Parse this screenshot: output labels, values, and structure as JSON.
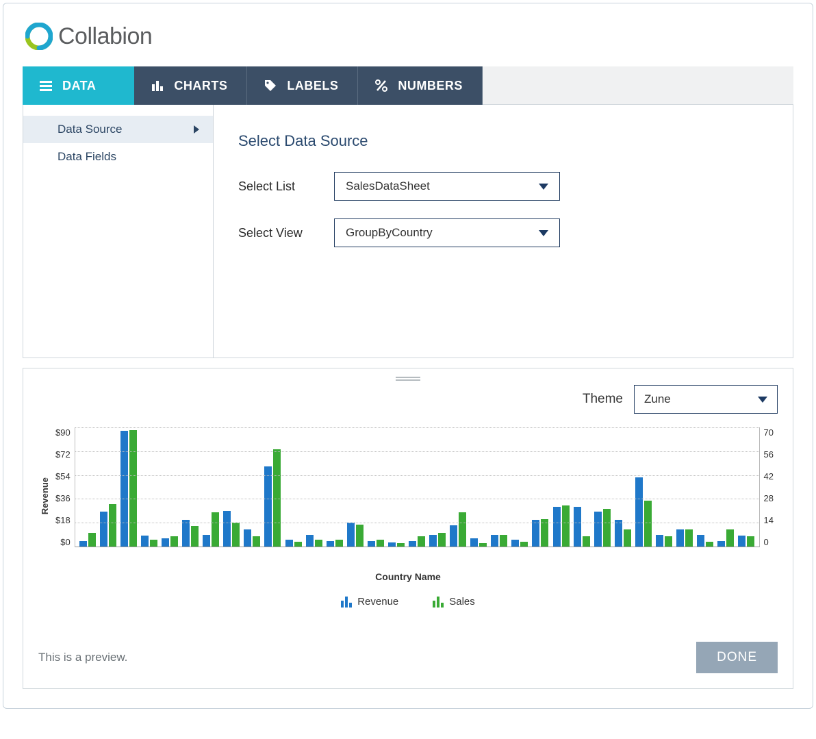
{
  "brand": {
    "name": "Collabion"
  },
  "tabs": [
    {
      "key": "data",
      "label": "DATA",
      "active": true
    },
    {
      "key": "charts",
      "label": "CHARTS",
      "active": false
    },
    {
      "key": "labels",
      "label": "LABELS",
      "active": false
    },
    {
      "key": "numbers",
      "label": "NUMBERS",
      "active": false
    }
  ],
  "sidebar": {
    "items": [
      {
        "key": "data-source",
        "label": "Data Source",
        "active": true
      },
      {
        "key": "data-fields",
        "label": "Data Fields",
        "active": false
      }
    ]
  },
  "content": {
    "title": "Select Data Source",
    "select_list_label": "Select List",
    "select_list_value": "SalesDataSheet",
    "select_view_label": "Select View",
    "select_view_value": "GroupByCountry"
  },
  "preview": {
    "theme_label": "Theme",
    "theme_value": "Zune",
    "note": "This is a preview.",
    "done_label": "DONE"
  },
  "chart_data": {
    "type": "bar",
    "xlabel": "Country Name",
    "ylabel": "Revenue",
    "y_left_ticks": [
      "$90",
      "$72",
      "$54",
      "$36",
      "$18",
      "$0"
    ],
    "y_right_ticks": [
      "70",
      "56",
      "42",
      "28",
      "14",
      "0"
    ],
    "y_left_max": 90,
    "y_right_max": 70,
    "legend": [
      {
        "name": "Revenue",
        "color": "#1f78c9"
      },
      {
        "name": "Sales",
        "color": "#3aaa35"
      }
    ],
    "series": [
      {
        "name": "Revenue",
        "axis": "left",
        "values": [
          4,
          26,
          87,
          8,
          6,
          20,
          9,
          27,
          13,
          60,
          5,
          9,
          4,
          18,
          4,
          3,
          4,
          9,
          16,
          6,
          9,
          5,
          20,
          30,
          30,
          26,
          20,
          52,
          9,
          13,
          9,
          4,
          8
        ]
      },
      {
        "name": "Sales",
        "axis": "right",
        "values": [
          8,
          25,
          68,
          4,
          6,
          12,
          20,
          14,
          6,
          57,
          3,
          4,
          4,
          13,
          4,
          2,
          6,
          8,
          20,
          2,
          7,
          3,
          16,
          24,
          6,
          22,
          10,
          27,
          6,
          10,
          3,
          10,
          6
        ]
      }
    ]
  }
}
